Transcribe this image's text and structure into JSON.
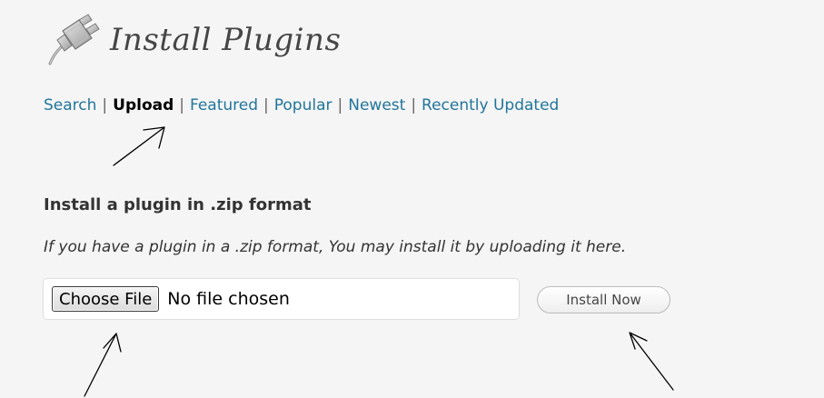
{
  "header": {
    "title": "Install Plugins",
    "icon": "plugin-icon"
  },
  "subnav": {
    "items": [
      {
        "label": "Search",
        "current": false
      },
      {
        "label": "Upload",
        "current": true
      },
      {
        "label": "Featured",
        "current": false
      },
      {
        "label": "Popular",
        "current": false
      },
      {
        "label": "Newest",
        "current": false
      },
      {
        "label": "Recently Updated",
        "current": false
      }
    ],
    "separator": "|"
  },
  "upload": {
    "section_title": "Install a plugin in .zip format",
    "description": "If you have a plugin in a .zip format, You may install it by uploading it here.",
    "choose_file_label": "Choose File",
    "file_status": "No file chosen",
    "install_button_label": "Install Now"
  },
  "colors": {
    "link": "#21759b",
    "text": "#333333",
    "title": "#464646",
    "background": "#f5f5f5"
  }
}
